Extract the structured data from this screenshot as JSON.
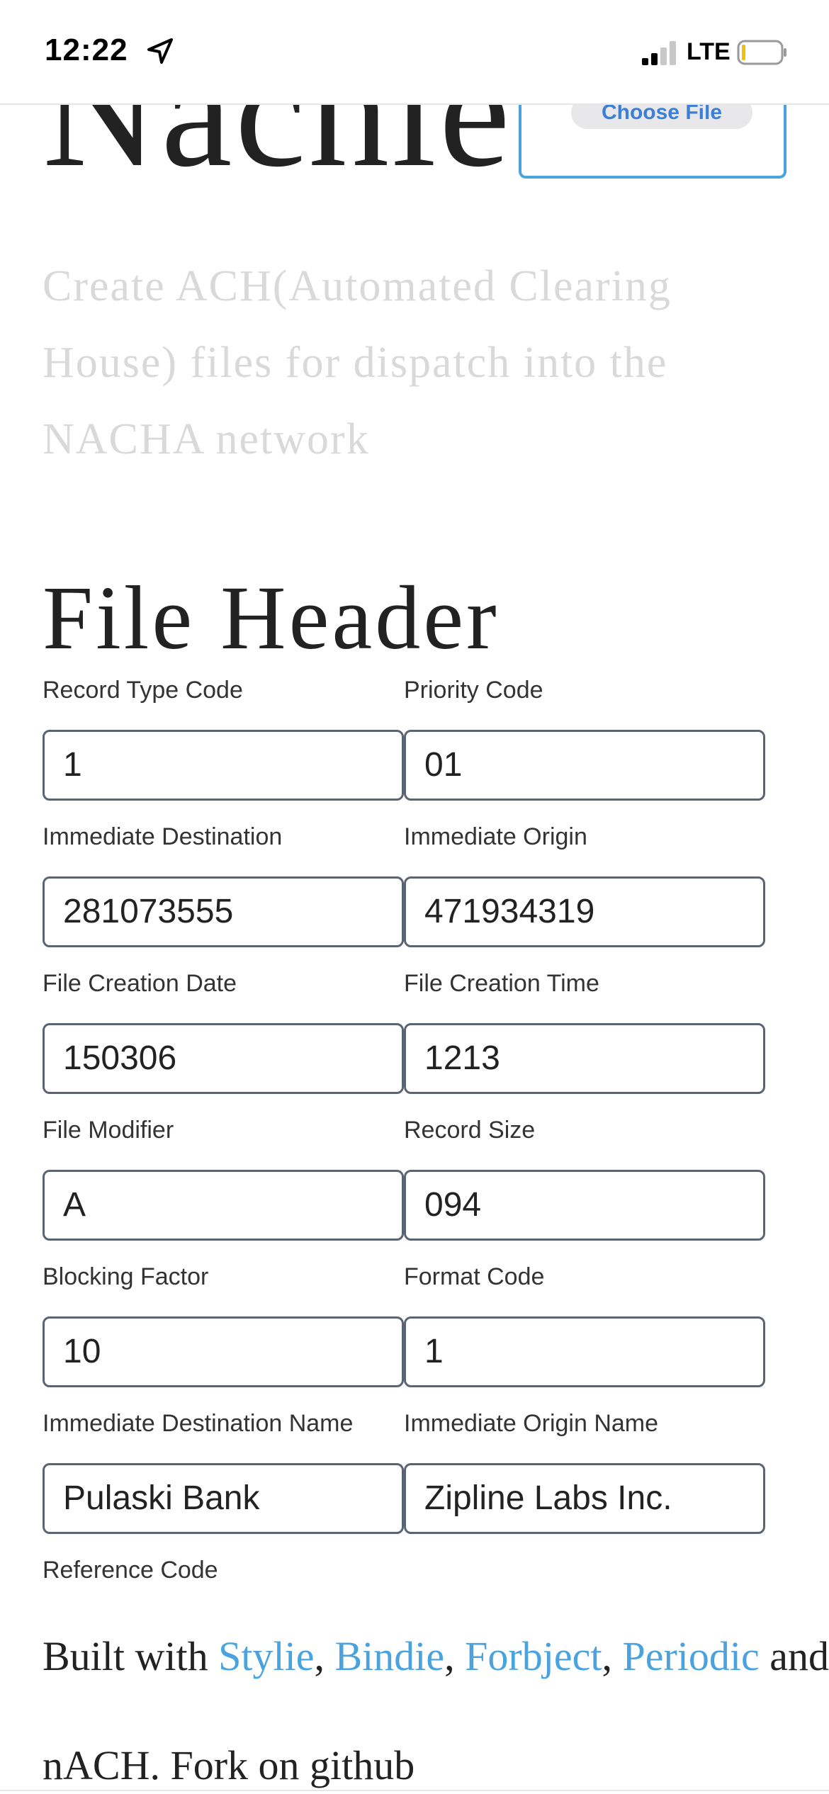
{
  "status_bar": {
    "time": "12:22",
    "network": "LTE",
    "icons": [
      "location-arrow-icon",
      "signal-icon",
      "battery-icon"
    ]
  },
  "app": {
    "title": "Nachie",
    "choose_file_label": "Choose File",
    "subtitle": "Create ACH(Automated Clearing House) files for dispatch into the NACHA network"
  },
  "file_header": {
    "title": "File Header",
    "fields": [
      {
        "label": "Record Type Code",
        "value": "1"
      },
      {
        "label": "Priority Code",
        "value": "01"
      },
      {
        "label": "Immediate Destination",
        "value": "281073555"
      },
      {
        "label": "Immediate Origin",
        "value": "471934319"
      },
      {
        "label": "File Creation Date",
        "value": "150306"
      },
      {
        "label": "File Creation Time",
        "value": "1213"
      },
      {
        "label": "File Modifier",
        "value": "A"
      },
      {
        "label": "Record Size",
        "value": "094"
      },
      {
        "label": "Blocking Factor",
        "value": "10"
      },
      {
        "label": "Format Code",
        "value": "1"
      },
      {
        "label": "Immediate Destination Name",
        "value": "Pulaski Bank"
      },
      {
        "label": "Immediate Origin Name",
        "value": "Zipline Labs Inc."
      },
      {
        "label": "Reference Code"
      }
    ]
  },
  "footer": {
    "built_with": "Built with",
    "links": [
      "Stylie",
      "Bindie",
      "Forbject",
      "Periodic",
      "nACH",
      "github"
    ],
    "comma": ",",
    "and": "and",
    "period_fork": ". Fork on"
  },
  "colors": {
    "link": "#4aa3df",
    "input_border": "#5a6472",
    "subtitle": "#d9d9d9",
    "button_text": "#3b7fd6"
  }
}
